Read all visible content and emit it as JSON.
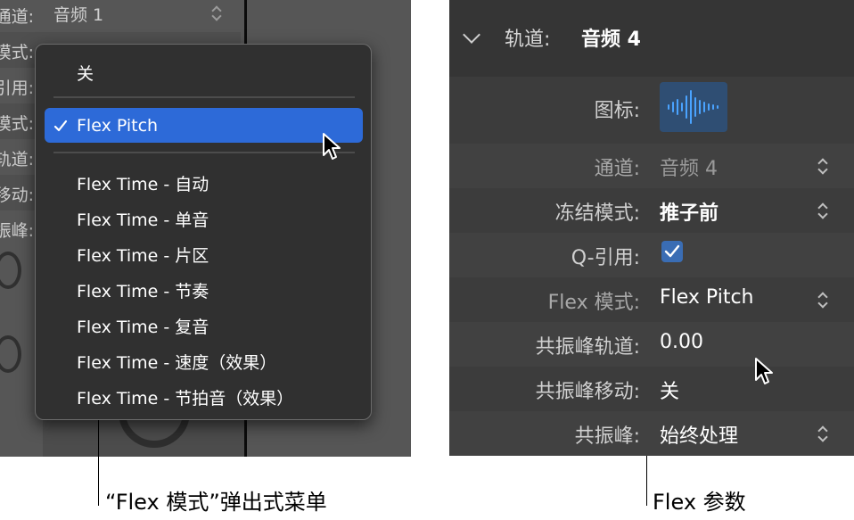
{
  "left_panel": {
    "rows": [
      {
        "label": "通道:",
        "value": "音频 1"
      },
      {
        "label": "模式:",
        "value": ""
      },
      {
        "label": "引用:",
        "value": ""
      },
      {
        "label": "模式:",
        "value": ""
      },
      {
        "label": "轨道:",
        "value": ""
      },
      {
        "label": "移动:",
        "value": ""
      },
      {
        "label": "振峰:",
        "value": ""
      }
    ]
  },
  "popup_menu": {
    "off": "关",
    "selected": "Flex Pitch",
    "items": [
      "Flex Time - 自动",
      "Flex Time - 单音",
      "Flex Time - 片区",
      "Flex Time - 节奏",
      "Flex Time - 复音",
      "Flex Time - 速度（效果）",
      "Flex Time - 节拍音（效果）"
    ]
  },
  "inspector": {
    "header_label": "轨道:",
    "header_title": "音频 4",
    "rows": {
      "icon_label": "图标:",
      "channel_label": "通道:",
      "channel_value": "音频 4",
      "freeze_label": "冻结模式:",
      "freeze_value": "推子前",
      "qref_label": "Q-引用:",
      "flex_label": "Flex 模式:",
      "flex_value": "Flex Pitch",
      "formant_track_label": "共振峰轨道:",
      "formant_track_value": "0.00",
      "formant_shift_label": "共振峰移动:",
      "formant_shift_value": "关",
      "formant_label": "共振峰:",
      "formant_value": "始终处理"
    }
  },
  "captions": {
    "left": "“Flex 模式”弹出式菜单",
    "right": "Flex 参数"
  },
  "colors": {
    "selection": "#2d6ad8",
    "checkbox": "#3a6db4",
    "icon_wave": "#4aa3ff"
  }
}
